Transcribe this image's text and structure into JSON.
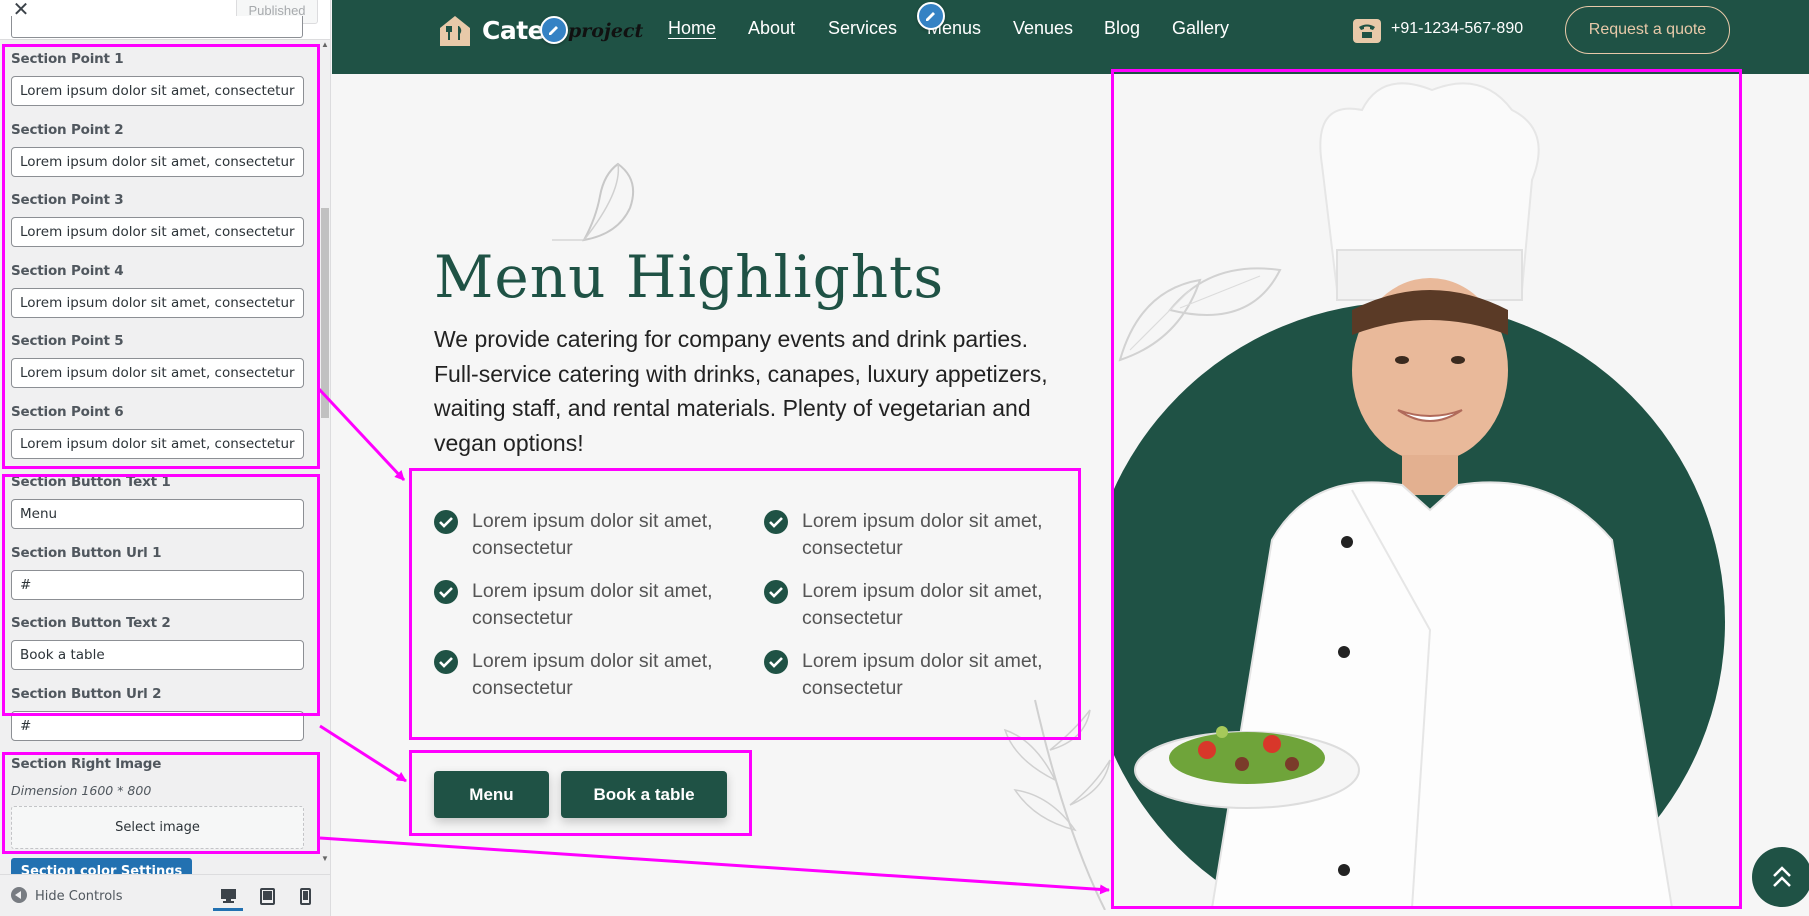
{
  "customizer": {
    "close_symbol": "✕",
    "published_label": "Published",
    "fields": [
      {
        "label": "Section Point 1",
        "value": "Lorem ipsum dolor sit amet, consectetur"
      },
      {
        "label": "Section Point 2",
        "value": "Lorem ipsum dolor sit amet, consectetur"
      },
      {
        "label": "Section Point 3",
        "value": "Lorem ipsum dolor sit amet, consectetur"
      },
      {
        "label": "Section Point 4",
        "value": "Lorem ipsum dolor sit amet, consectetur"
      },
      {
        "label": "Section Point 5",
        "value": "Lorem ipsum dolor sit amet, consectetur"
      },
      {
        "label": "Section Point 6",
        "value": "Lorem ipsum dolor sit amet, consectetur"
      },
      {
        "label": "Section Button Text 1",
        "value": "Menu"
      },
      {
        "label": "Section Button Url 1",
        "value": "#"
      },
      {
        "label": "Section Button Text 2",
        "value": "Book a table"
      },
      {
        "label": "Section Button Url 2",
        "value": "#"
      }
    ],
    "right_image": {
      "label": "Section Right Image",
      "dimension": "Dimension 1600 * 800",
      "select_label": "Select image"
    },
    "color_settings_label": "Section color Settings",
    "hide_controls_label": "Hide Controls"
  },
  "site": {
    "logo_text": "Cateri",
    "logo_sub": "project",
    "nav": [
      "Home",
      "About",
      "Services",
      "Menus",
      "Venues",
      "Blog",
      "Gallery"
    ],
    "phone": "+91-1234-567-890",
    "quote_label": "Request a quote"
  },
  "section": {
    "title": "Menu Highlights",
    "description": "We provide catering for company events and drink parties. Full-service catering with drinks, canapes, luxury appetizers, waiting staff, and rental materials. Plenty of vegetarian and vegan options!",
    "points": [
      "Lorem ipsum dolor sit amet, consectetur",
      "Lorem ipsum dolor sit amet, consectetur",
      "Lorem ipsum dolor sit amet, consectetur",
      "Lorem ipsum dolor sit amet, consectetur",
      "Lorem ipsum dolor sit amet, consectetur",
      "Lorem ipsum dolor sit amet, consectetur"
    ],
    "button_1": "Menu",
    "button_2": "Book a table"
  },
  "colors": {
    "brand_green": "#1f5245",
    "accent_beige": "#e8c9a9",
    "annotation_magenta": "#ff00ff",
    "wp_blue": "#2271b1"
  },
  "icons": [
    "close-icon",
    "pencil-icon",
    "phone-icon",
    "check-icon",
    "chevron-up-icon",
    "desktop-icon",
    "tablet-icon",
    "mobile-icon",
    "chef-image"
  ]
}
